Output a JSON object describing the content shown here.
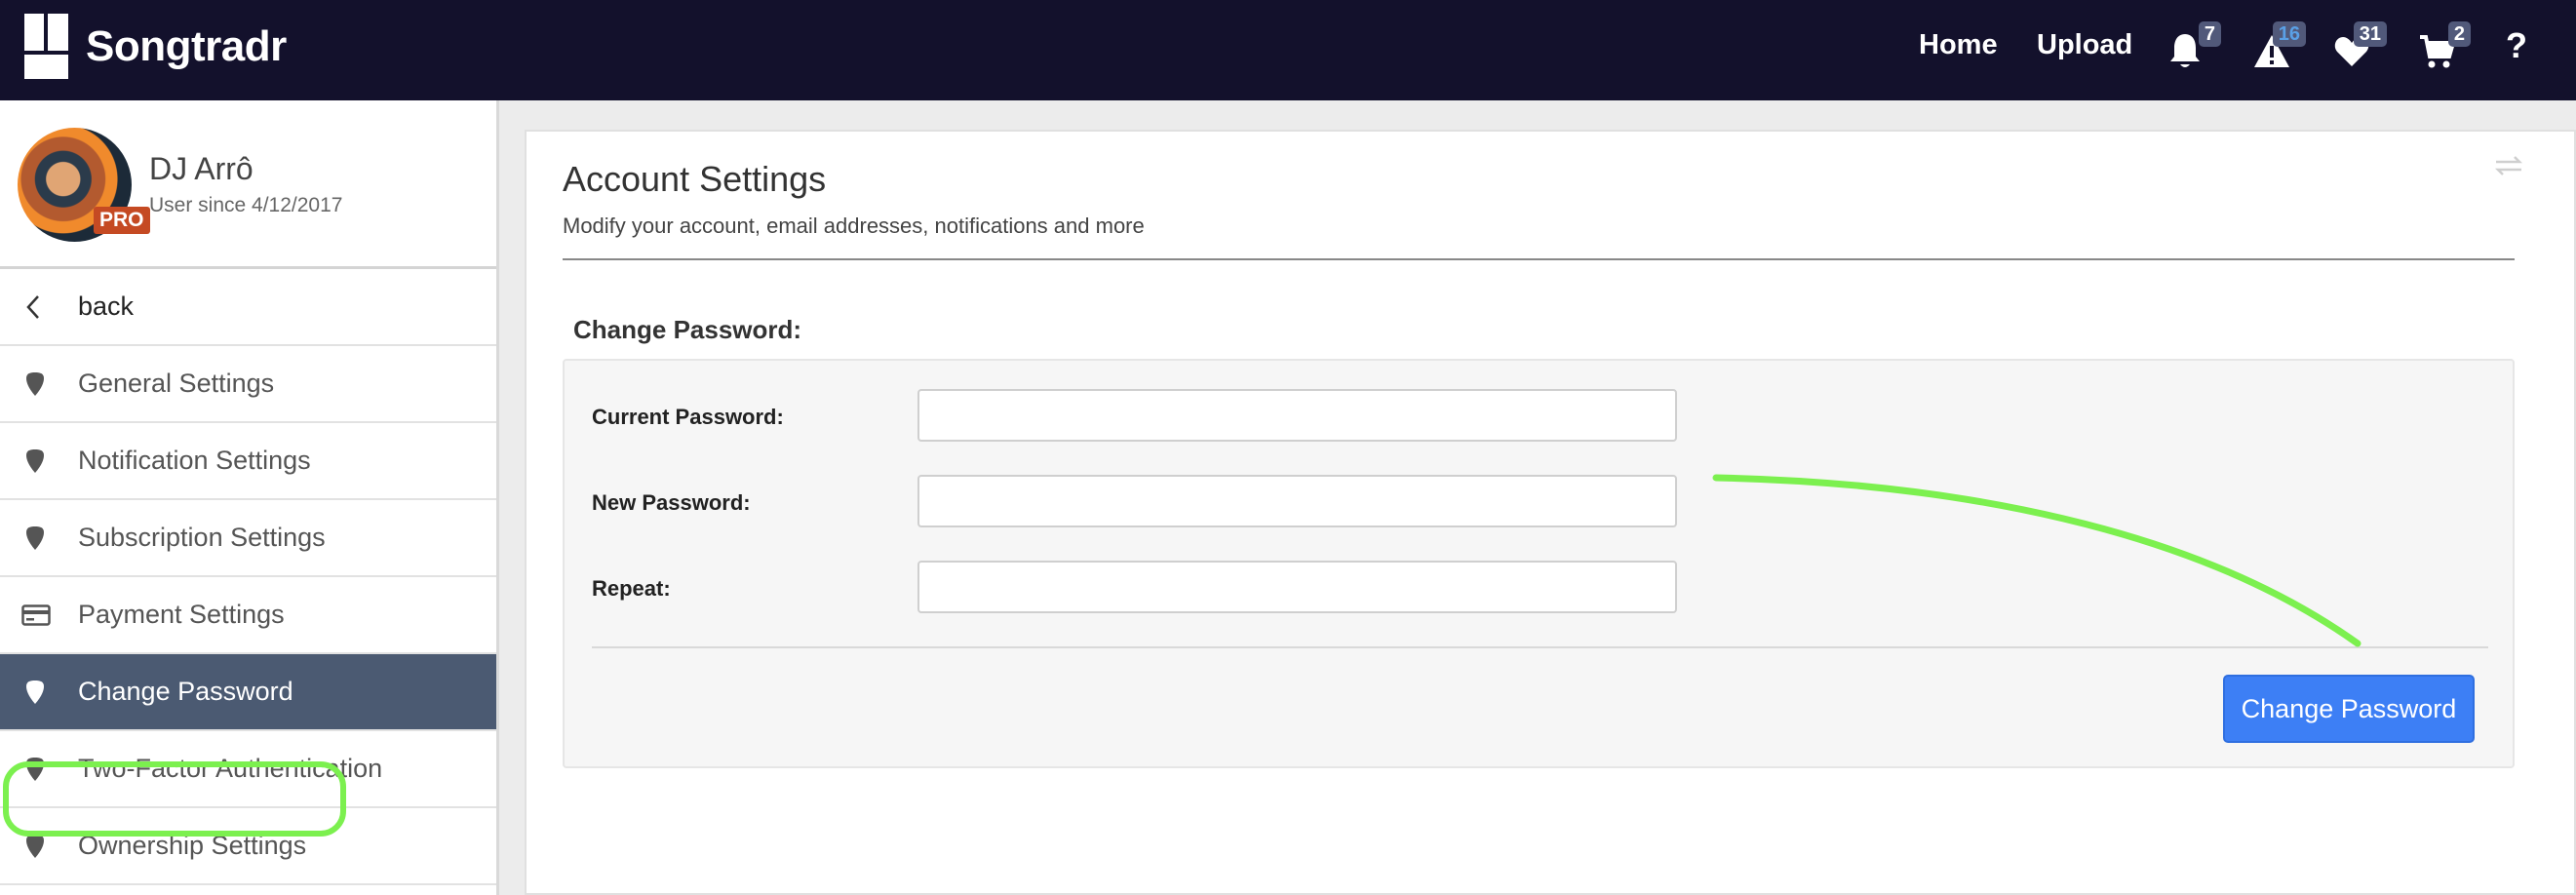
{
  "topbar": {
    "logo_text": "Songtradr",
    "nav": {
      "home": "Home",
      "upload": "Upload",
      "help": "?"
    },
    "badges": {
      "notifications": "7",
      "alerts": "16",
      "favorites": "31",
      "cart": "2"
    }
  },
  "sidebar": {
    "profile": {
      "name": "DJ Arrô",
      "since": "User since 4/12/2017",
      "pro_label": "PRO"
    },
    "back_label": "back",
    "items": [
      {
        "label": "General Settings"
      },
      {
        "label": "Notification Settings"
      },
      {
        "label": "Subscription Settings"
      },
      {
        "label": "Payment Settings"
      },
      {
        "label": "Change Password"
      },
      {
        "label": "Two-Factor Authentication"
      },
      {
        "label": "Ownership Settings"
      }
    ]
  },
  "main": {
    "title": "Account Settings",
    "subtitle": "Modify your account, email addresses, notifications and more",
    "section_label": "Change Password:",
    "fields": [
      {
        "label": "Current Password:",
        "value": ""
      },
      {
        "label": "New Password:",
        "value": ""
      },
      {
        "label": "Repeat:",
        "value": ""
      }
    ],
    "submit_label": "Change Password"
  },
  "colors": {
    "topbar": "#13112c",
    "active_item": "#4b5a72",
    "button": "#3d7ff5",
    "annotation": "#7cf04f"
  }
}
